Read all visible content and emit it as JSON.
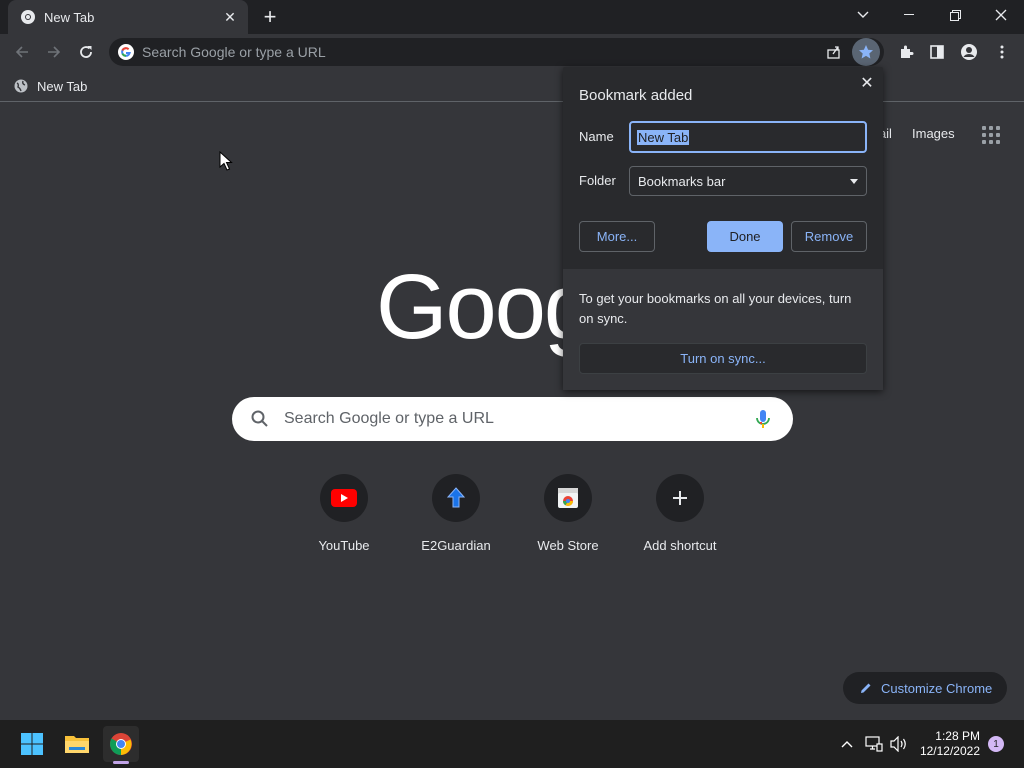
{
  "window": {
    "tab_title": "New Tab"
  },
  "toolbar": {
    "omnibox_placeholder": "Search Google or type a URL"
  },
  "bookmarks_bar": {
    "items": [
      {
        "label": "New Tab"
      }
    ]
  },
  "page": {
    "header_links": [
      "Gmail",
      "Images"
    ],
    "logo_text": "Google",
    "search_placeholder": "Search Google or type a URL",
    "shortcuts": [
      {
        "label": "YouTube",
        "icon": "youtube-icon"
      },
      {
        "label": "E2Guardian",
        "icon": "e2guardian-icon"
      },
      {
        "label": "Web Store",
        "icon": "web-store-icon"
      },
      {
        "label": "Add shortcut",
        "icon": "plus-icon"
      }
    ],
    "customize_label": "Customize Chrome"
  },
  "bookmark_popup": {
    "title": "Bookmark added",
    "name_label": "Name",
    "name_value": "New Tab",
    "folder_label": "Folder",
    "folder_value": "Bookmarks bar",
    "more_label": "More...",
    "done_label": "Done",
    "remove_label": "Remove",
    "sync_text": "To get your bookmarks on all your devices, turn on sync.",
    "sync_button": "Turn on sync..."
  },
  "taskbar": {
    "time": "1:28 PM",
    "date": "12/12/2022",
    "notification_count": "1"
  },
  "colors": {
    "accent": "#8ab4f8",
    "page_bg": "#35363a",
    "frame_bg": "#202124",
    "popup_bg": "#292a2d"
  }
}
